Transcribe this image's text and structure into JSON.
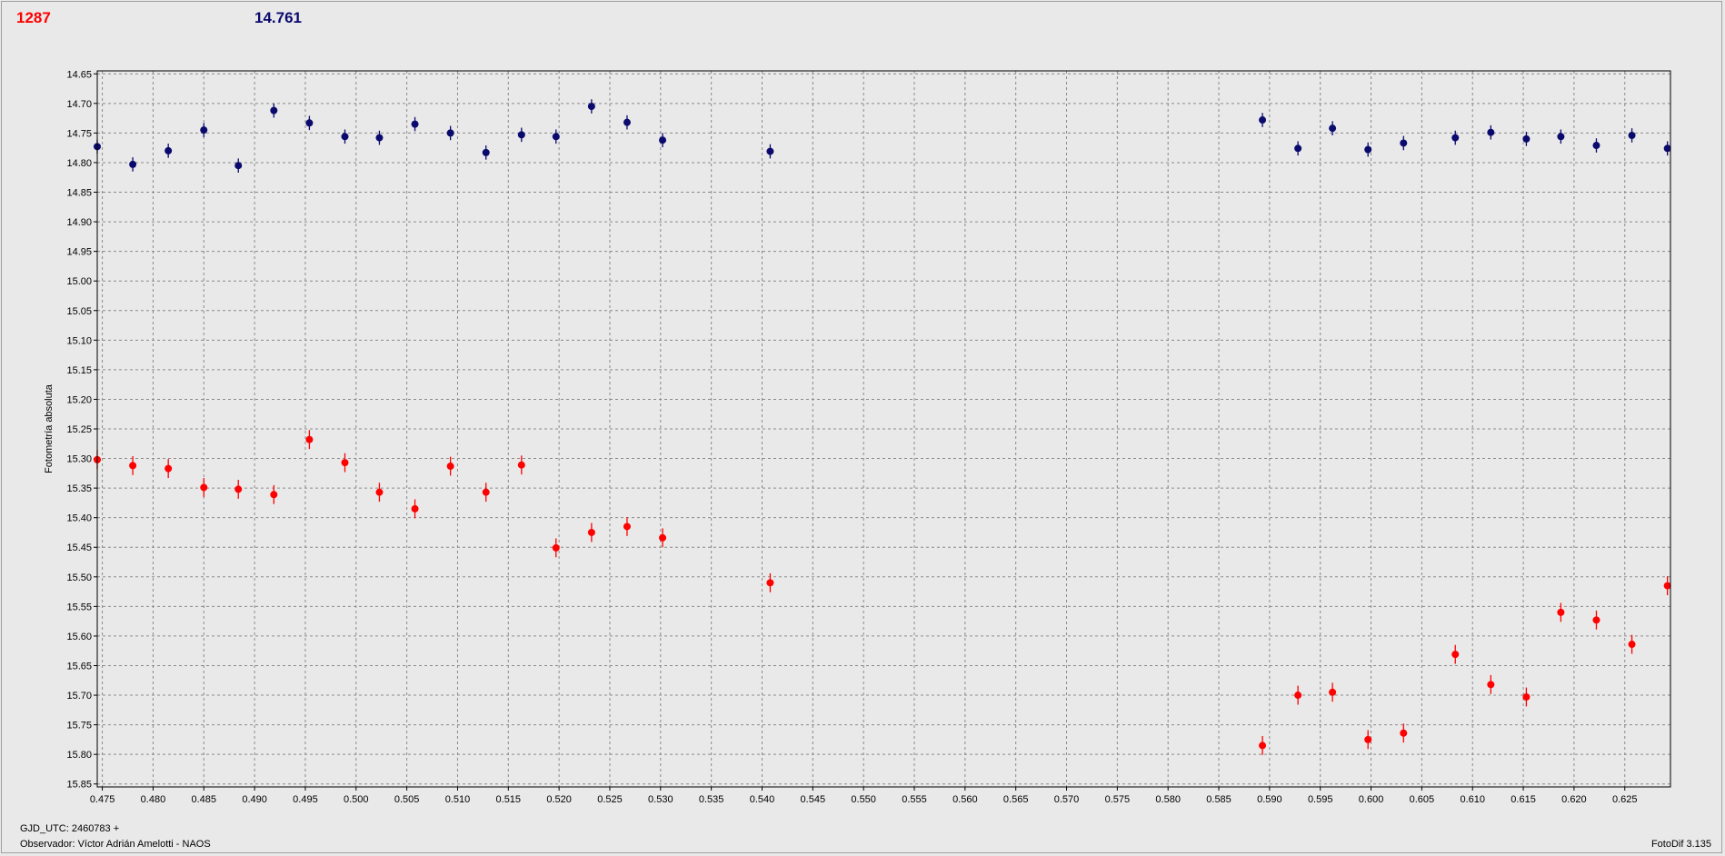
{
  "header": {
    "red_value": "1287",
    "blue_value": "14.761",
    "red_color": "#ff0000",
    "blue_color": "#0a0a6e"
  },
  "footer": {
    "gjd": "GJD_UTC: 2460783 +",
    "observer": "Observador: Víctor Adrián Amelotti - NAOS",
    "version": "FotoDif 3.135"
  },
  "chart_data": {
    "type": "scatter",
    "ylabel": "Fotometría absoluta",
    "xlabel": "",
    "xlim": [
      0.4745,
      0.6295
    ],
    "ylim": [
      15.855,
      14.645
    ],
    "y_inverted": true,
    "grid": true,
    "x_ticks": [
      "0.475",
      "0.480",
      "0.485",
      "0.490",
      "0.495",
      "0.500",
      "0.505",
      "0.510",
      "0.515",
      "0.520",
      "0.525",
      "0.530",
      "0.535",
      "0.540",
      "0.545",
      "0.550",
      "0.555",
      "0.560",
      "0.565",
      "0.570",
      "0.575",
      "0.580",
      "0.585",
      "0.590",
      "0.595",
      "0.600",
      "0.605",
      "0.610",
      "0.615",
      "0.620",
      "0.625"
    ],
    "y_ticks": [
      "14.65",
      "14.70",
      "14.75",
      "14.80",
      "14.85",
      "14.90",
      "14.95",
      "15.00",
      "15.05",
      "15.10",
      "15.15",
      "15.20",
      "15.25",
      "15.30",
      "15.35",
      "15.40",
      "15.45",
      "15.50",
      "15.55",
      "15.60",
      "15.65",
      "15.70",
      "15.75",
      "15.80",
      "15.85"
    ],
    "series": [
      {
        "color": "#0a0a6e",
        "err": 0.012,
        "x": [
          0.4745,
          0.478,
          0.4815,
          0.485,
          0.4884,
          0.4919,
          0.4954,
          0.4989,
          0.5023,
          0.5058,
          0.5093,
          0.5128,
          0.5163,
          0.5197,
          0.5232,
          0.5267,
          0.5302,
          0.5408,
          0.5893,
          0.5928,
          0.5962,
          0.5997,
          0.6032,
          0.6083,
          0.6118,
          0.6153,
          0.6187,
          0.6222,
          0.6257,
          0.6292
        ],
        "y": [
          14.773,
          14.803,
          14.78,
          14.745,
          14.805,
          14.712,
          14.733,
          14.756,
          14.758,
          14.735,
          14.75,
          14.783,
          14.753,
          14.756,
          14.705,
          14.732,
          14.762,
          14.781,
          14.728,
          14.776,
          14.742,
          14.778,
          14.767,
          14.758,
          14.749,
          14.76,
          14.756,
          14.771,
          14.754,
          14.776
        ]
      },
      {
        "color": "#ff0000",
        "err": 0.016,
        "x": [
          0.4745,
          0.478,
          0.4815,
          0.485,
          0.4884,
          0.4919,
          0.4954,
          0.4989,
          0.5023,
          0.5058,
          0.5093,
          0.5128,
          0.5163,
          0.5197,
          0.5232,
          0.5267,
          0.5302,
          0.5408,
          0.5893,
          0.5928,
          0.5962,
          0.5997,
          0.6032,
          0.6083,
          0.6118,
          0.6153,
          0.6187,
          0.6222,
          0.6257,
          0.6292
        ],
        "y": [
          15.302,
          15.312,
          15.317,
          15.349,
          15.352,
          15.361,
          15.268,
          15.307,
          15.357,
          15.385,
          15.313,
          15.357,
          15.311,
          15.451,
          15.425,
          15.415,
          15.434,
          15.51,
          15.785,
          15.7,
          15.695,
          15.775,
          15.764,
          15.631,
          15.682,
          15.703,
          15.56,
          15.573,
          15.614,
          15.515
        ]
      }
    ]
  }
}
